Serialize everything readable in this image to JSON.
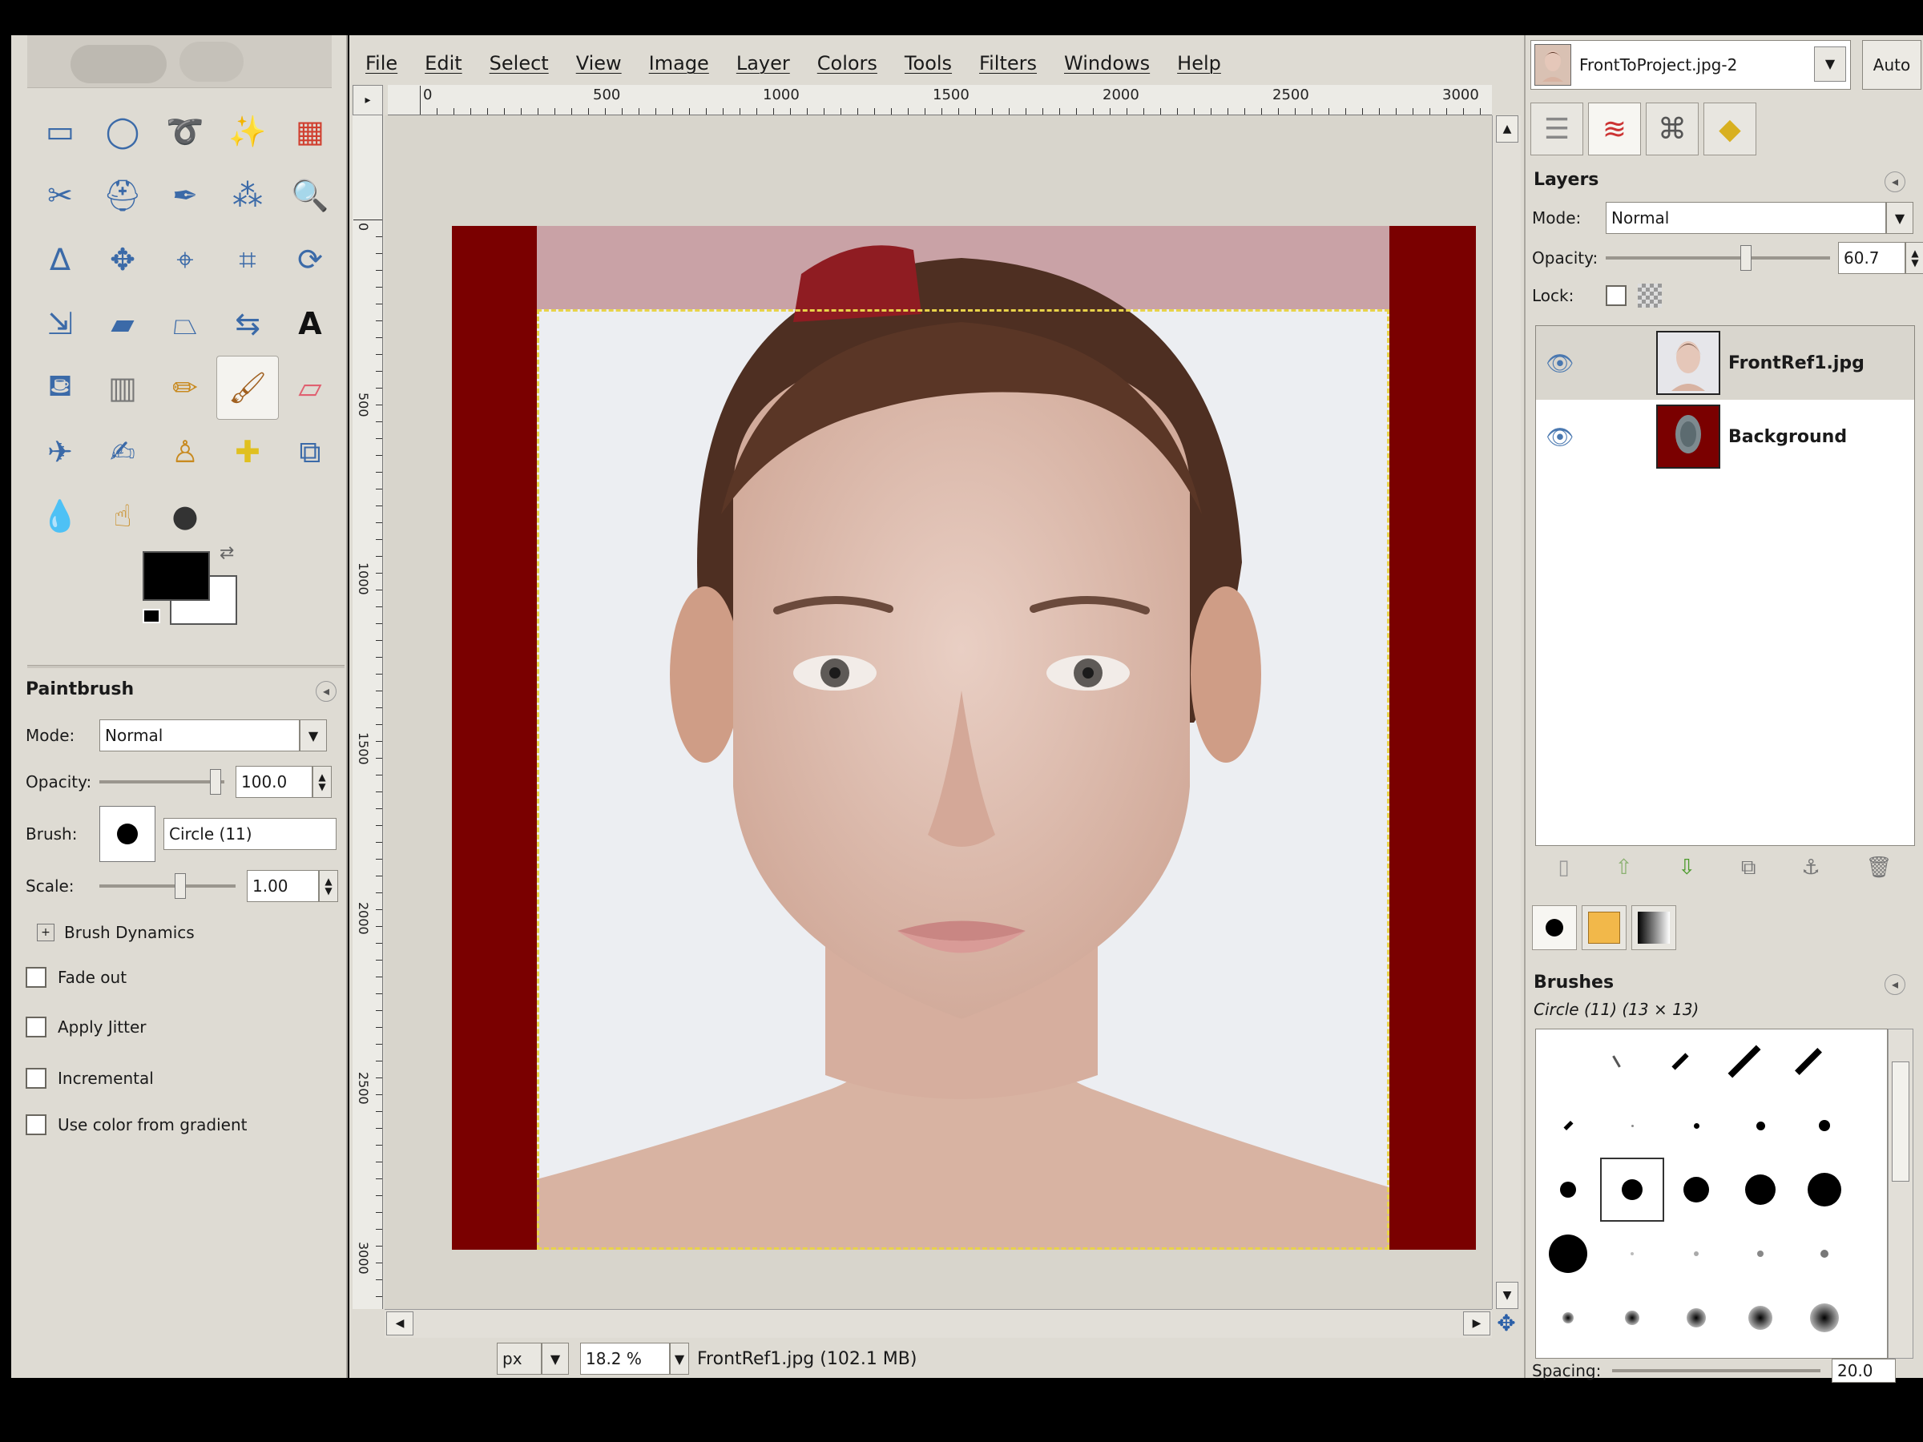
{
  "menubar": {
    "items": [
      "File",
      "Edit",
      "Select",
      "View",
      "Image",
      "Layer",
      "Colors",
      "Tools",
      "Filters",
      "Windows",
      "Help"
    ]
  },
  "ruler": {
    "h_labels": [
      "0",
      "500",
      "1000",
      "1500",
      "2000",
      "2500",
      "3000"
    ],
    "v_labels": [
      "0",
      "500",
      "1000",
      "1500",
      "2000",
      "2500",
      "3000"
    ]
  },
  "toolbox": {
    "tools": [
      "rect-select",
      "ellipse-select",
      "free-select",
      "fuzzy-select",
      "select-by-color",
      "scissors-select",
      "foreground-select",
      "paths",
      "color-picker",
      "zoom",
      "measure",
      "move",
      "align",
      "crop",
      "rotate",
      "scale",
      "shear",
      "perspective",
      "flip",
      "text",
      "bucket-fill",
      "blend",
      "pencil",
      "paintbrush",
      "eraser",
      "airbrush",
      "ink",
      "clone",
      "heal",
      "perspective-clone",
      "blur-sharpen",
      "smudge",
      "dodge-burn"
    ],
    "active_tool": "paintbrush"
  },
  "colors": {
    "foreground": "#000000",
    "background": "#ffffff"
  },
  "tool_options": {
    "title": "Paintbrush",
    "mode_label": "Mode:",
    "mode_value": "Normal",
    "opacity_label": "Opacity:",
    "opacity_value": "100.0",
    "brush_label": "Brush:",
    "brush_value": "Circle (11)",
    "scale_label": "Scale:",
    "scale_value": "1.00",
    "brush_dynamics": "Brush Dynamics",
    "checkboxes": [
      "Fade out",
      "Apply Jitter",
      "Incremental",
      "Use color from gradient"
    ]
  },
  "status": {
    "unit": "px",
    "zoom": "18.2 %",
    "file_info": "FrontRef1.jpg (102.1 MB)"
  },
  "dock": {
    "image_name": "FrontToProject.jpg-2",
    "auto_label": "Auto",
    "layers": {
      "title": "Layers",
      "mode_label": "Mode:",
      "mode_value": "Normal",
      "opacity_label": "Opacity:",
      "opacity_value": "60.7",
      "opacity_fraction": 0.607,
      "lock_label": "Lock:",
      "items": [
        {
          "name": "FrontRef1.jpg",
          "selected": true
        },
        {
          "name": "Background",
          "selected": false
        }
      ]
    },
    "brushes": {
      "title": "Brushes",
      "current": "Circle (11) (13 × 13)",
      "spacing_label": "Spacing:",
      "spacing_value": "20.0"
    }
  },
  "palette": {
    "canvas_border": "#7a0000",
    "photo_bg": "#eceef2",
    "selection": "#e8d34a"
  }
}
